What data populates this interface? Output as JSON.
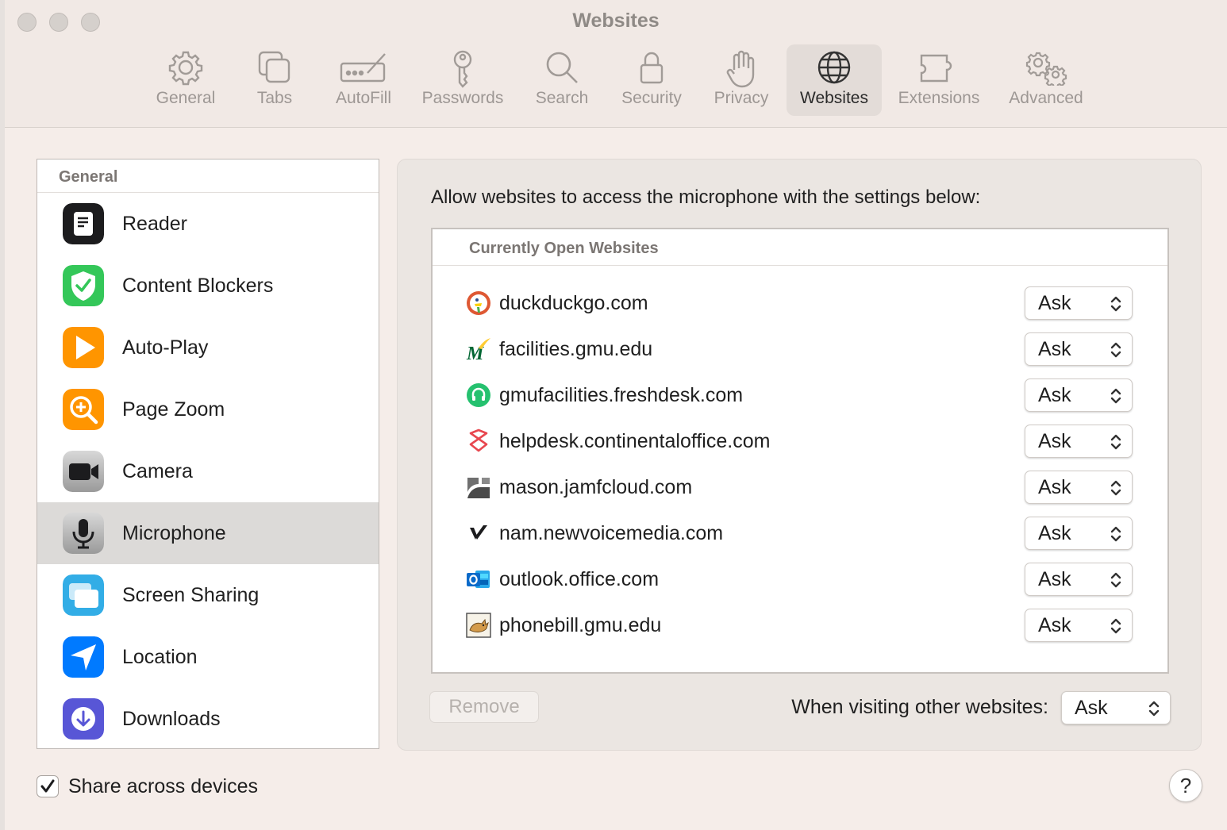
{
  "window": {
    "title": "Websites"
  },
  "toolbar": {
    "items": [
      {
        "label": "General",
        "icon": "gear-icon"
      },
      {
        "label": "Tabs",
        "icon": "tabs-icon"
      },
      {
        "label": "AutoFill",
        "icon": "autofill-icon"
      },
      {
        "label": "Passwords",
        "icon": "key-icon"
      },
      {
        "label": "Search",
        "icon": "magnifier-icon"
      },
      {
        "label": "Security",
        "icon": "lock-icon"
      },
      {
        "label": "Privacy",
        "icon": "hand-icon"
      },
      {
        "label": "Websites",
        "icon": "globe-icon",
        "selected": true
      },
      {
        "label": "Extensions",
        "icon": "puzzle-icon"
      },
      {
        "label": "Advanced",
        "icon": "gears-icon"
      }
    ]
  },
  "sidebar": {
    "header": "General",
    "selected": "Microphone",
    "items": [
      {
        "label": "Reader",
        "icon": "reader-icon",
        "color": "#1c1c1e"
      },
      {
        "label": "Content Blockers",
        "icon": "shield-check-icon",
        "color": "#34c759"
      },
      {
        "label": "Auto-Play",
        "icon": "play-icon",
        "color": "#ff9500"
      },
      {
        "label": "Page Zoom",
        "icon": "zoom-icon",
        "color": "#ff9500"
      },
      {
        "label": "Camera",
        "icon": "camera-icon",
        "color": "#8e8e93"
      },
      {
        "label": "Microphone",
        "icon": "microphone-icon",
        "color": "#8e8e93"
      },
      {
        "label": "Screen Sharing",
        "icon": "screen-sharing-icon",
        "color": "#32ade6"
      },
      {
        "label": "Location",
        "icon": "location-arrow-icon",
        "color": "#007aff"
      },
      {
        "label": "Downloads",
        "icon": "download-icon",
        "color": "#5856d6"
      }
    ]
  },
  "main": {
    "heading": "Allow websites to access the microphone with the settings below:",
    "list_header": "Currently Open Websites",
    "sites": [
      {
        "domain": "duckduckgo.com",
        "setting": "Ask",
        "icon": "duckduckgo-icon"
      },
      {
        "domain": "facilities.gmu.edu",
        "setting": "Ask",
        "icon": "gmu-icon"
      },
      {
        "domain": "gmufacilities.freshdesk.com",
        "setting": "Ask",
        "icon": "freshdesk-icon"
      },
      {
        "domain": "helpdesk.continentaloffice.com",
        "setting": "Ask",
        "icon": "continentaloffice-icon"
      },
      {
        "domain": "mason.jamfcloud.com",
        "setting": "Ask",
        "icon": "jamf-icon"
      },
      {
        "domain": "nam.newvoicemedia.com",
        "setting": "Ask",
        "icon": "newvoicemedia-icon"
      },
      {
        "domain": "outlook.office.com",
        "setting": "Ask",
        "icon": "outlook-icon"
      },
      {
        "domain": "phonebill.gmu.edu",
        "setting": "Ask",
        "icon": "tomcat-icon"
      }
    ],
    "remove_label": "Remove",
    "other_label": "When visiting other websites:",
    "other_setting": "Ask"
  },
  "footer": {
    "share_label": "Share across devices",
    "share_checked": true,
    "help_label": "?"
  }
}
